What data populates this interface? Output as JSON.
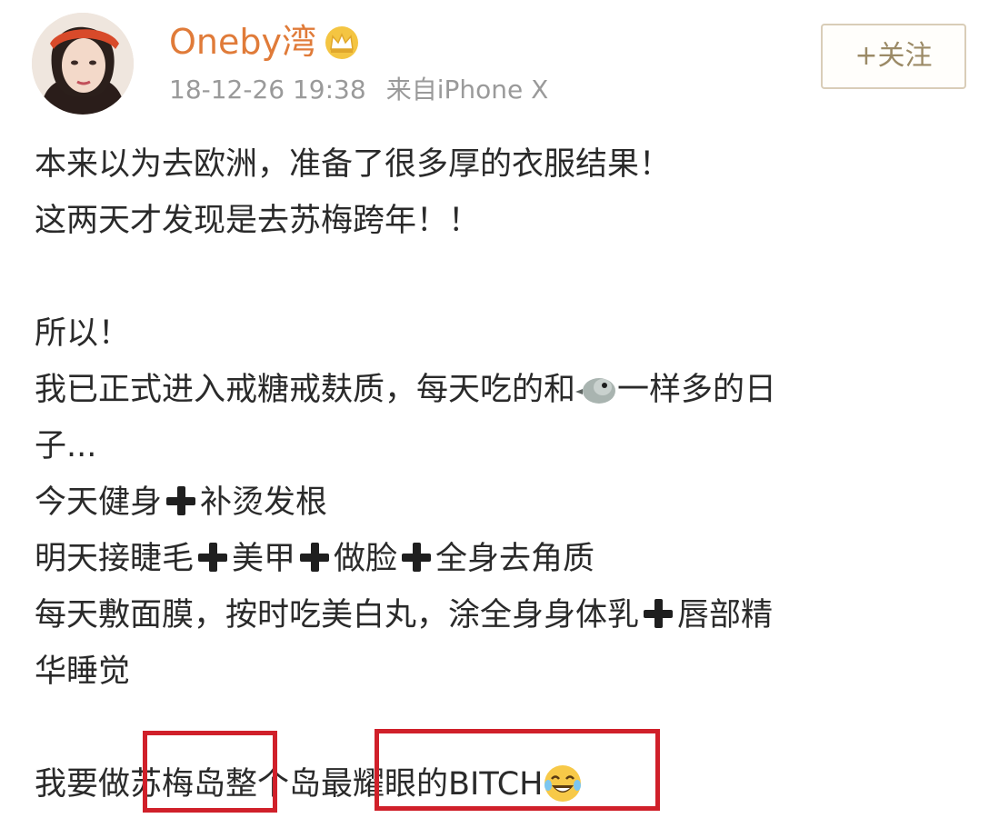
{
  "post": {
    "username": "Oneby湾",
    "timestamp": "18-12-26 19:38",
    "source": "来自iPhone X",
    "follow_label": "+关注",
    "badge_icon": "crown-icon",
    "colors": {
      "username": "#e07b39",
      "highlight": "#d0202a",
      "meta": "#9a9a9a"
    },
    "lines": {
      "l1": "本来以为去欧洲，准备了很多厚的衣服结果！",
      "l2": "这两天才发现是去苏梅跨年！！",
      "l3": "所以！",
      "l4a": "我已正式进入戒糖戒麸质，每天吃的和",
      "l4b": "一样多的日",
      "l5": "子...",
      "l6a": "今天健身",
      "l6b": "补烫发根",
      "l7a": "明天接睫毛",
      "l7b": "美甲",
      "l7c": "做脸",
      "l7d": "全身去角质",
      "l8a": "每天敷面膜，按时吃美白丸，涂全身身体乳",
      "l8b": "唇部精",
      "l9": "华睡觉",
      "l10a": "我要做",
      "l10b": "苏梅岛",
      "l10c": "整个岛",
      "l10d": "最耀眼的BITCH"
    }
  }
}
